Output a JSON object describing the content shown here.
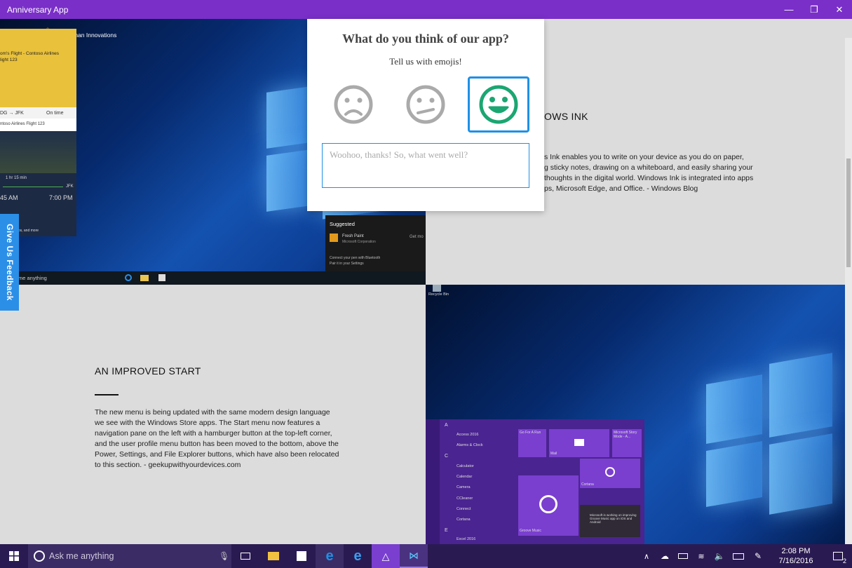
{
  "window": {
    "title": "Anniversary App",
    "controls": [
      "minimize",
      "restore",
      "close"
    ]
  },
  "feedback_tab": {
    "label": "Give Us Feedback"
  },
  "dialog": {
    "question": "What do you think of our app?",
    "subtitle": "Tell us with emojis!",
    "emojis": [
      {
        "name": "sad-face",
        "selected": false
      },
      {
        "name": "meh-face",
        "selected": false
      },
      {
        "name": "happy-face",
        "selected": true
      }
    ],
    "feedback_placeholder": "Woohoo, thanks! So, what went well?",
    "accent": "#1e90e6",
    "happy_color": "#1ba672"
  },
  "sections": {
    "ink": {
      "title": "OWS INK",
      "body": [
        "s Ink enables you to write on your device as you do on paper,",
        "g sticky notes, drawing on a whiteboard, and easily sharing your",
        "thoughts in the digital world. Windows Ink is integrated into apps",
        "ps, Microsoft Edge, and Office. - Windows Blog"
      ]
    },
    "start": {
      "title": "AN IMPROVED START",
      "body": [
        "The new menu is being updated with the same modern design language",
        "we see with the Windows Store apps. The Start menu now features a",
        "navigation pane on the left with a hamburger button at the top-left corner,",
        "and the user profile menu button has been moved to the bottom, above the",
        "Power, Settings, and File Explorer buttons, which have also been relocated",
        "to this section. - geekupwithyourdevices.com"
      ]
    }
  },
  "screenshot1": {
    "company": "Techman Innovations",
    "flight_card": {
      "title": "om's Flight - Contoso Airlines",
      "sub": "light 123",
      "route": "DG → JFK",
      "status": "On time",
      "airline": "ntoso Airlines Flight 123",
      "duration": "1 hr 15 min",
      "dest": "JFK",
      "dep_time": "45 AM",
      "arr_time": "7:00 PM",
      "more": "tination, maps, and more"
    },
    "suggested": {
      "heading": "Suggested",
      "app": "Fresh Paint",
      "publisher": "Microsoft Corporation",
      "get": "Get mo",
      "tip1": "Connect your pen with Bluetooth",
      "tip2": "Pair it in your Settings"
    },
    "search_text": "me anything"
  },
  "screenshot2": {
    "recycle": "Recycle Bin",
    "start_items": [
      "Access 2016",
      "Alarms & Clock",
      "Calculator",
      "Calendar",
      "Camera",
      "CCleaner",
      "Connect",
      "Cortana",
      "Excel 2016"
    ],
    "letters": [
      "A",
      "C",
      "E"
    ],
    "tiles": [
      "Go For A Run",
      "Microsoft Story Mode - A...",
      "Mail",
      "Store",
      "Cortana",
      "Groove Music",
      "Microsoft is working on improving Groove Music app on iOS and Android"
    ]
  },
  "taskbar": {
    "search_placeholder": "Ask me anything",
    "time": "2:08 PM",
    "date": "7/16/2016",
    "notifications": "2"
  },
  "colors": {
    "titlebar": "#7a2fc8",
    "taskbar": "#2a1a52",
    "feedback_tab": "#2b8fe8"
  }
}
